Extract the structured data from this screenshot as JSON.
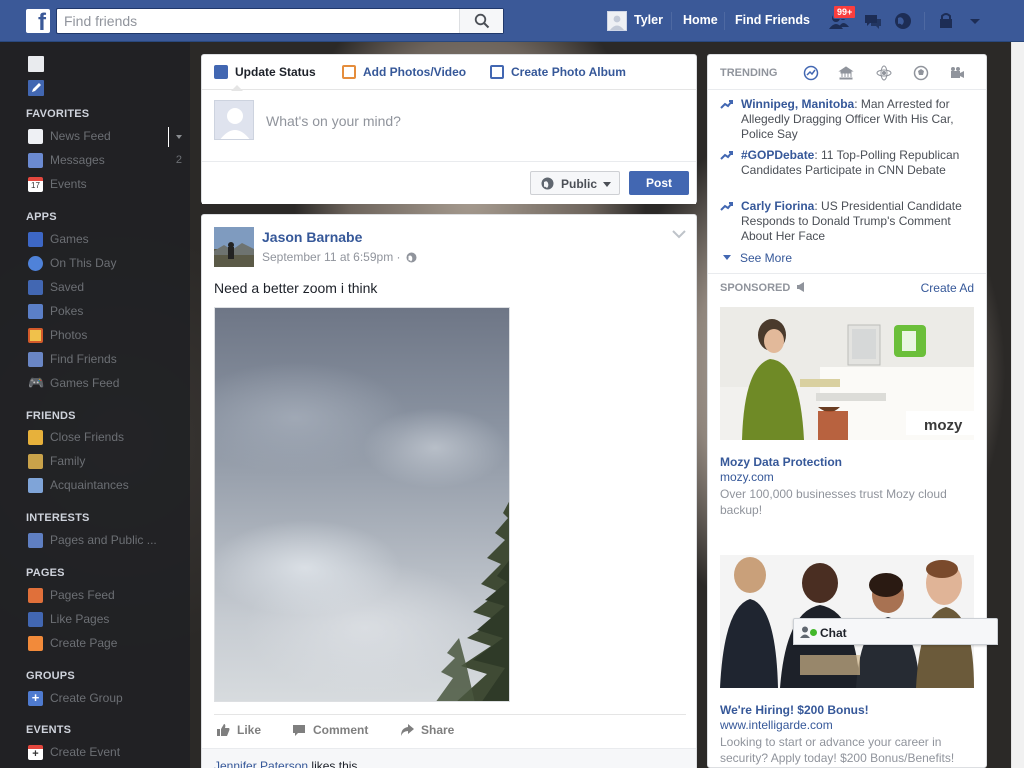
{
  "topbar": {
    "logo": "f",
    "search_placeholder": "Find friends",
    "user_name": "Tyler",
    "links": [
      "Home",
      "Find Friends"
    ],
    "friend_requests_badge": "99+",
    "brand_color": "#3b5998"
  },
  "left_nav": {
    "sections": [
      {
        "title": "FAVORITES",
        "items": [
          {
            "label": "News Feed",
            "icon": "news-feed-icon",
            "count": ""
          },
          {
            "label": "Messages",
            "icon": "messages-icon",
            "count": "2"
          },
          {
            "label": "Events",
            "icon": "events-icon",
            "count": ""
          }
        ]
      },
      {
        "title": "APPS",
        "items": [
          {
            "label": "Games",
            "icon": "games-icon"
          },
          {
            "label": "On This Day",
            "icon": "on-this-day-icon"
          },
          {
            "label": "Saved",
            "icon": "saved-icon"
          },
          {
            "label": "Pokes",
            "icon": "pokes-icon"
          },
          {
            "label": "Photos",
            "icon": "photos-icon"
          },
          {
            "label": "Find Friends",
            "icon": "find-friends-icon"
          },
          {
            "label": "Games Feed",
            "icon": "games-feed-icon"
          }
        ]
      },
      {
        "title": "FRIENDS",
        "items": [
          {
            "label": "Close Friends",
            "icon": "close-friends-icon"
          },
          {
            "label": "Family",
            "icon": "family-icon"
          },
          {
            "label": "Acquaintances",
            "icon": "acquaintances-icon"
          }
        ]
      },
      {
        "title": "INTERESTS",
        "items": [
          {
            "label": "Pages and Public ...",
            "icon": "pages-public-icon"
          }
        ]
      },
      {
        "title": "PAGES",
        "items": [
          {
            "label": "Pages Feed",
            "icon": "pages-feed-icon"
          },
          {
            "label": "Like Pages",
            "icon": "like-pages-icon"
          },
          {
            "label": "Create Page",
            "icon": "create-page-icon"
          }
        ]
      },
      {
        "title": "GROUPS",
        "items": [
          {
            "label": "Create Group",
            "icon": "create-group-icon"
          }
        ]
      },
      {
        "title": "EVENTS",
        "items": [
          {
            "label": "Create Event",
            "icon": "create-event-icon"
          }
        ]
      }
    ],
    "events_icon_day": "17"
  },
  "composer": {
    "tabs": [
      "Update Status",
      "Add Photos/Video",
      "Create Photo Album"
    ],
    "placeholder": "What's on your mind?",
    "privacy_label": "Public",
    "post_label": "Post"
  },
  "story": {
    "author": "Jason Barnabe",
    "timestamp": "September 11 at 6:59pm ·",
    "text": "Need a better zoom i think",
    "actions": [
      "Like",
      "Comment",
      "Share"
    ],
    "likes_name": "Jennifer Paterson",
    "likes_suffix": " likes this."
  },
  "trending": {
    "title": "TRENDING",
    "items": [
      {
        "topic": "Winnipeg, Manitoba",
        "headline": ": Man Arrested for Allegedly Dragging Officer With His Car, Police Say"
      },
      {
        "topic": "#GOPDebate",
        "headline": ": 11 Top-Polling Republican Candidates Participate in CNN Debate"
      },
      {
        "topic": "Carly Fiorina",
        "headline": ": US Presidential Candidate Responds to Donald Trump's Comment About Her Face"
      }
    ],
    "see_more": "See More"
  },
  "sponsored": {
    "title": "SPONSORED",
    "create_ad": "Create Ad",
    "ads": [
      {
        "title": "Mozy Data Protection",
        "url": "mozy.com",
        "description": "Over 100,000 businesses trust Mozy cloud backup!",
        "brand_text": "mozy"
      },
      {
        "title": "We're Hiring! $200 Bonus!",
        "url": "www.intelligarde.com",
        "description": "Looking to start or advance your career in security? Apply today! $200 Bonus/Benefits!"
      }
    ]
  },
  "chat": {
    "label": "Chat"
  }
}
